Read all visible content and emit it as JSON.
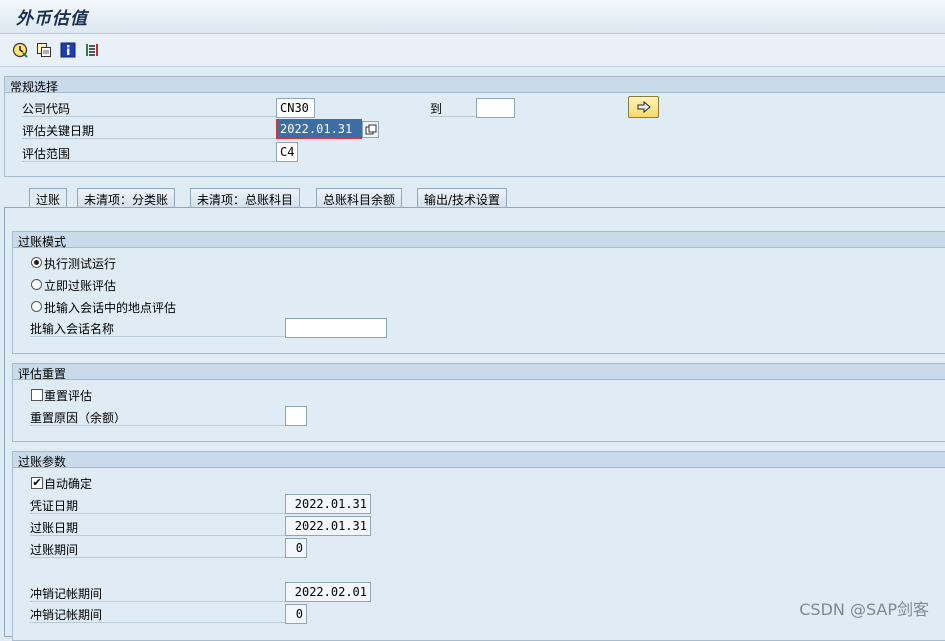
{
  "window": {
    "title": "外币估值"
  },
  "toolbar": {
    "icons": [
      "execute-clock-icon",
      "copy-variant-icon",
      "info-icon",
      "multi-selection-icon"
    ]
  },
  "general_selection": {
    "title": "常规选择",
    "company_code_label": "公司代码",
    "company_code_value": "CN30",
    "to_label": "到",
    "to_value": "",
    "valuation_key_date_label": "评估关键日期",
    "valuation_key_date_value": "2022.01.31",
    "valuation_area_label": "评估范围",
    "valuation_area_value": "C4"
  },
  "tabs": [
    {
      "label": "过账",
      "active": true
    },
    {
      "label": "未清项：分类账",
      "active": false
    },
    {
      "label": "未清项：总账科目",
      "active": false
    },
    {
      "label": "总账科目余额",
      "active": false
    },
    {
      "label": "输出/技术设置",
      "active": false
    }
  ],
  "posting_mode": {
    "title": "过账模式",
    "option_test_run": "执行测试运行",
    "option_immediate_post": "立即过账评估",
    "option_batch_input": "批输入会话中的地点评估",
    "selected_option": "执行测试运行",
    "batch_session_name_label": "批输入会话名称",
    "batch_session_name_value": ""
  },
  "valuation_reset": {
    "title": "评估重置",
    "reset_valuation_label": "重置评估",
    "reset_valuation_checked": false,
    "reset_reason_label": "重置原因（余额）",
    "reset_reason_value": ""
  },
  "posting_params": {
    "title": "过账参数",
    "auto_confirm_label": "自动确定",
    "auto_confirm_checked": true,
    "document_date_label": "凭证日期",
    "document_date_value": "2022.01.31",
    "posting_date_label": "过账日期",
    "posting_date_value": "2022.01.31",
    "posting_period_label": "过账期间",
    "posting_period_value": "0",
    "reversal_posting_date_label": "冲销记帐期间",
    "reversal_posting_date_value": "2022.02.01",
    "reversal_posting_period_label": "冲销记帐期间",
    "reversal_posting_period_value": "0"
  },
  "watermark": "CSDN @SAP剑客"
}
